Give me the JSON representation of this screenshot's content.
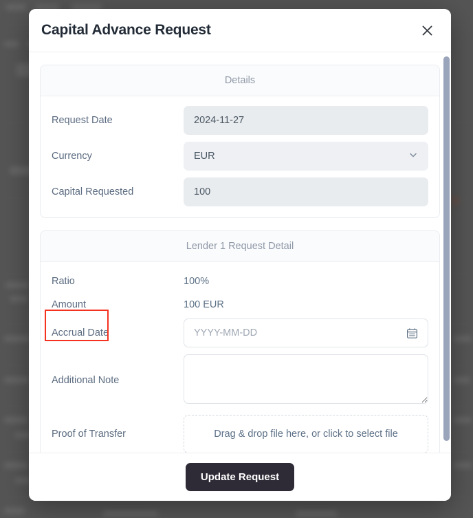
{
  "backdrop": {
    "overlay_color": "#6f6f6f"
  },
  "modal": {
    "title": "Capital Advance Request",
    "close_label": "×",
    "sections": [
      {
        "heading": "Details",
        "rows": [
          {
            "label": "Request Date",
            "kind": "text-disabled",
            "value": "2024-11-27"
          },
          {
            "label": "Currency",
            "kind": "select",
            "value": "EUR"
          },
          {
            "label": "Capital Requested",
            "kind": "text-disabled",
            "value": "100"
          }
        ]
      },
      {
        "heading": "Lender 1 Request Detail",
        "rows": [
          {
            "label": "Ratio",
            "kind": "static",
            "value": "100%"
          },
          {
            "label": "Amount",
            "kind": "static",
            "value": "100 EUR"
          },
          {
            "label": "Accrual Date",
            "kind": "date",
            "value": "",
            "placeholder": "YYYY-MM-DD"
          },
          {
            "label": "Additional Note",
            "kind": "textarea",
            "value": "",
            "placeholder": ""
          },
          {
            "label": "Proof of Transfer",
            "kind": "dropzone",
            "value": "Drag & drop file here, or click to select file"
          }
        ]
      }
    ],
    "footer": {
      "submit_label": "Update Request"
    },
    "annotation": {
      "target": "Accrual Date",
      "color": "#f5321f"
    },
    "scrollbar": {
      "thumb_color": "#9aa5bb"
    }
  }
}
